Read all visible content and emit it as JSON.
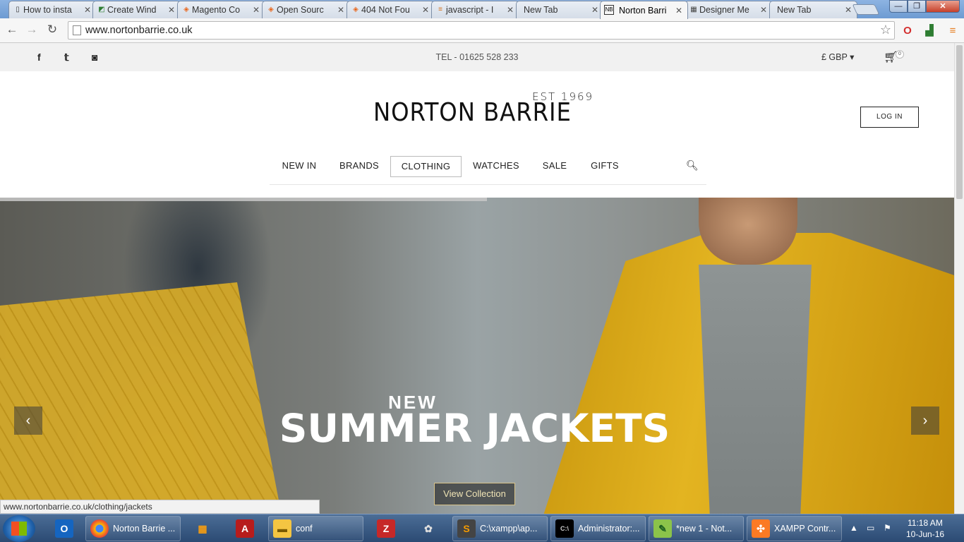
{
  "browser": {
    "tabs": [
      {
        "title": "How to insta",
        "favicon": "page-icon",
        "active": false
      },
      {
        "title": "Create Wind",
        "favicon": "green-doc-icon",
        "active": false
      },
      {
        "title": "Magento Co",
        "favicon": "magento-icon",
        "active": false
      },
      {
        "title": "Open Sourc",
        "favicon": "magento-icon",
        "active": false
      },
      {
        "title": "404 Not Fou",
        "favicon": "magento-icon",
        "active": false
      },
      {
        "title": "javascript - I",
        "favicon": "stackoverflow-icon",
        "active": false
      },
      {
        "title": "New Tab",
        "favicon": "",
        "active": false
      },
      {
        "title": "Norton Barri",
        "favicon": "nb-icon",
        "active": true
      },
      {
        "title": "Designer Me",
        "favicon": "designer-icon",
        "active": false
      },
      {
        "title": "New Tab",
        "favicon": "",
        "active": false
      }
    ],
    "url": "www.nortonbarrie.co.uk",
    "status_url": "www.nortonbarrie.co.uk/clothing/jackets"
  },
  "topbar": {
    "social": [
      "facebook-icon",
      "twitter-icon",
      "instagram-icon"
    ],
    "tel": "TEL - 01625 528 233",
    "currency": "£ GBP ▾",
    "cart_count": "0"
  },
  "header": {
    "logo_est": "EST 1969",
    "logo_name": "NORTON BARRIE",
    "login_label": "LOG IN"
  },
  "nav": {
    "items": [
      {
        "label": "NEW IN",
        "active": false
      },
      {
        "label": "BRANDS",
        "active": false
      },
      {
        "label": "CLOTHING",
        "active": true
      },
      {
        "label": "WATCHES",
        "active": false
      },
      {
        "label": "SALE",
        "active": false
      },
      {
        "label": "GIFTS",
        "active": false
      }
    ]
  },
  "hero": {
    "kicker": "NEW",
    "title": "SUMMER JACKETS",
    "cta": "View Collection",
    "slide_progress": 0.51
  },
  "taskbar": {
    "items": [
      {
        "label": "",
        "icon": "outlook-icon",
        "pinned": true
      },
      {
        "label": "Norton Barrie ...",
        "icon": "chrome-icon",
        "pinned": false
      },
      {
        "label": "",
        "icon": "apps-grid-icon",
        "pinned": true
      },
      {
        "label": "",
        "icon": "acrobat-icon",
        "pinned": true
      },
      {
        "label": "conf",
        "icon": "folder-icon",
        "pinned": false
      },
      {
        "label": "",
        "icon": "filezilla-icon",
        "pinned": true
      },
      {
        "label": "",
        "icon": "gimp-icon",
        "pinned": true
      },
      {
        "label": "C:\\xampp\\ap...",
        "icon": "sublime-icon",
        "pinned": false
      },
      {
        "label": "Administrator:...",
        "icon": "cmd-icon",
        "pinned": false
      },
      {
        "label": "*new 1 - Not...",
        "icon": "notepadpp-icon",
        "pinned": false
      },
      {
        "label": "XAMPP Contr...",
        "icon": "xampp-icon",
        "pinned": false
      }
    ],
    "time": "11:18 AM",
    "date": "10-Jun-16"
  },
  "colors": {
    "accent_gold": "#d9c48a",
    "chrome_blue": "#6d9bd2",
    "taskbar_blue": "#2b4a73"
  }
}
